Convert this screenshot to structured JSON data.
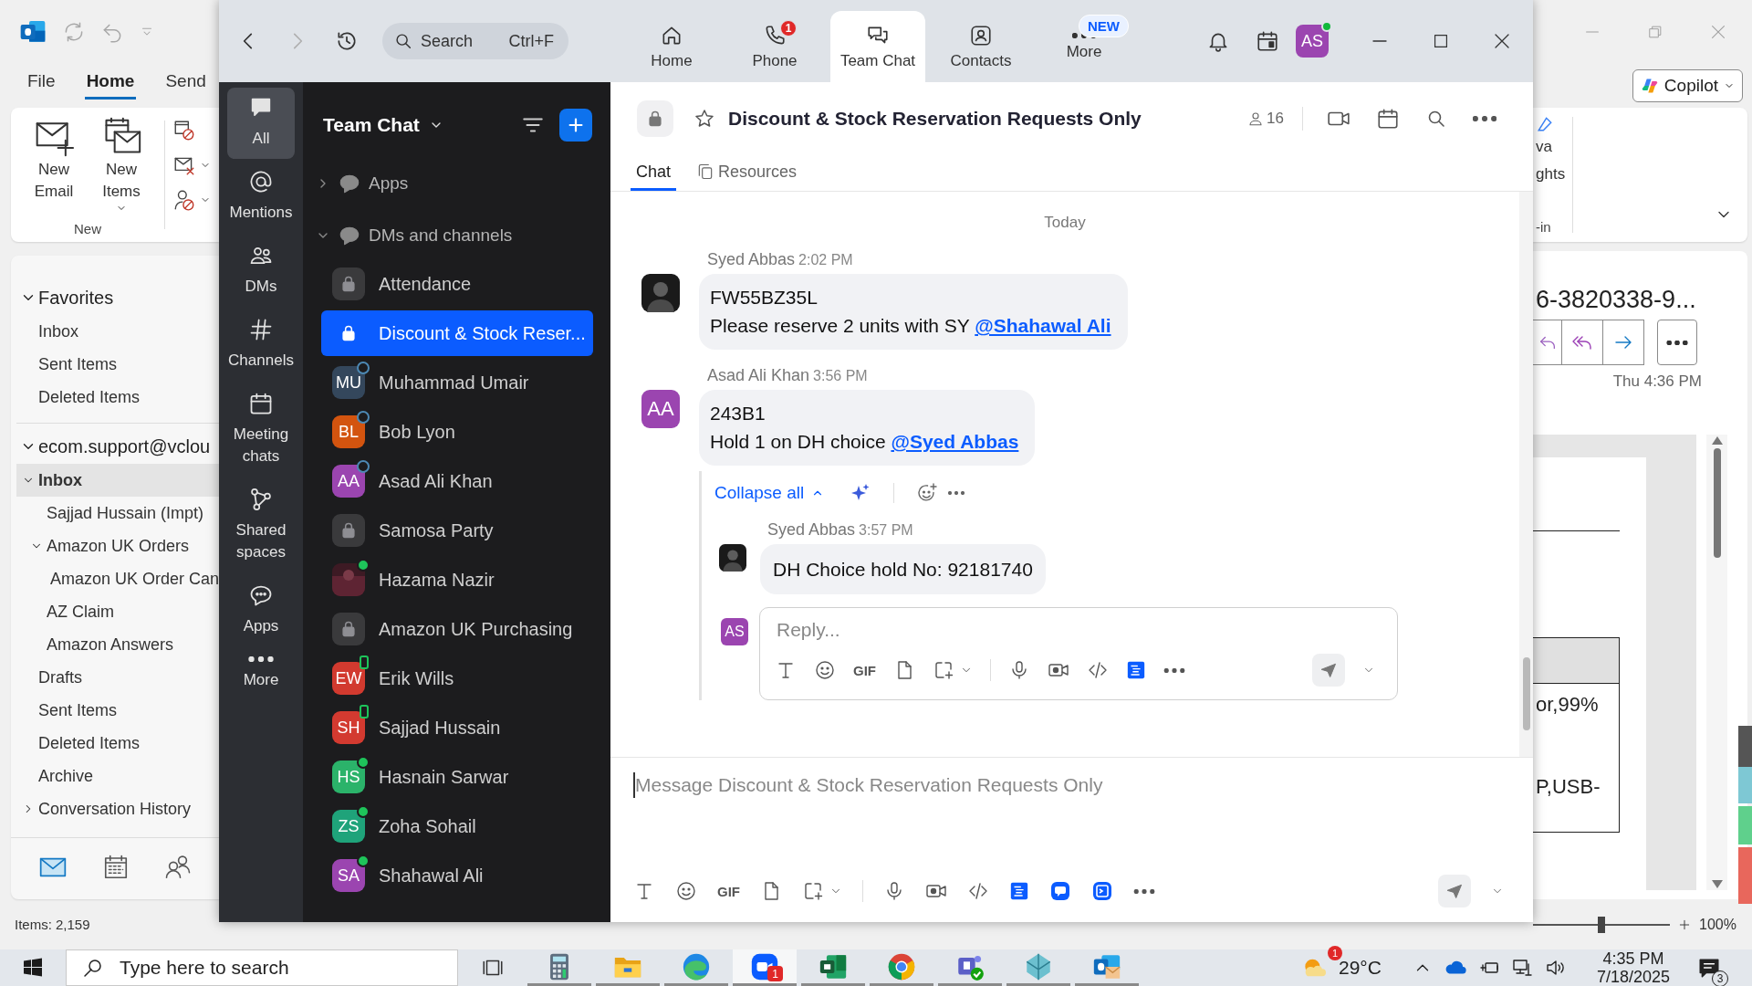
{
  "outlook": {
    "ribbon_tabs": [
      {
        "label": "File",
        "selected": false
      },
      {
        "label": "Home",
        "selected": true
      },
      {
        "label": "Send",
        "selected": false
      }
    ],
    "new_buttons": [
      {
        "kind": "email",
        "label": "New Email"
      },
      {
        "kind": "items",
        "label": "New Items"
      }
    ],
    "group_label": "New",
    "folders": [
      {
        "label": "Favorites",
        "kind": "header",
        "expanded": true,
        "selected": false,
        "children": [
          {
            "label": "Inbox",
            "selected": false
          },
          {
            "label": "Sent Items",
            "selected": false
          },
          {
            "label": "Deleted Items",
            "selected": false
          }
        ]
      },
      {
        "label": "ecom.support@vclou",
        "kind": "header",
        "expanded": true,
        "selected": false,
        "children": [
          {
            "label": "Inbox",
            "expanded": true,
            "selected": true,
            "children": [
              {
                "label": "Sajjad Hussain (Impt)",
                "selected": false
              },
              {
                "label": "Amazon UK Orders",
                "expanded": true,
                "selected": false,
                "children": [
                  {
                    "label": "Amazon UK Order Can",
                    "selected": false
                  }
                ]
              },
              {
                "label": "AZ Claim",
                "selected": false
              },
              {
                "label": "Amazon Answers",
                "selected": false
              }
            ]
          },
          {
            "label": "Drafts",
            "selected": false
          },
          {
            "label": "Sent Items",
            "selected": false
          },
          {
            "label": "Deleted Items",
            "selected": false
          },
          {
            "label": "Archive",
            "selected": false
          },
          {
            "label": "Conversation History",
            "expanded": false,
            "selected": false
          }
        ]
      }
    ],
    "status": "Items: 2,159",
    "copilot": "Copilot",
    "ribbon_fragment": {
      "lines": [
        "va",
        "ghts"
      ],
      "group_label": "-in"
    },
    "message": {
      "subject": "6-3820338-9...",
      "time": "Thu 4:36 PM",
      "cells": [
        "or,99%",
        "P,USB-"
      ]
    },
    "zoom_slider": {
      "level": 0.5
    },
    "zoom_level": "100%"
  },
  "zoom": {
    "search": {
      "placeholder": "Search",
      "shortcut": "Ctrl+F"
    },
    "nav_tabs": [
      {
        "kind": "home",
        "label": "Home",
        "selected": false
      },
      {
        "kind": "phone",
        "label": "Phone",
        "badge": "1",
        "selected": false
      },
      {
        "kind": "chat",
        "label": "Team Chat",
        "selected": true
      },
      {
        "kind": "contacts",
        "label": "Contacts",
        "selected": false
      },
      {
        "kind": "more",
        "label": "More",
        "badge": "NEW",
        "selected": false
      }
    ],
    "user_initials": "AS",
    "rail": [
      {
        "kind": "all",
        "label": "All",
        "selected": true
      },
      {
        "kind": "mentions",
        "label": "Mentions",
        "selected": false
      },
      {
        "kind": "dms",
        "label": "DMs",
        "selected": false
      },
      {
        "kind": "channels",
        "label": "Channels",
        "selected": false
      },
      {
        "kind": "meetings",
        "label": "Meeting chats",
        "selected": false
      },
      {
        "kind": "shared",
        "label": "Shared spaces",
        "selected": false
      },
      {
        "kind": "apps",
        "label": "Apps",
        "selected": false
      },
      {
        "kind": "more",
        "label": "More",
        "selected": false
      }
    ],
    "list_title": "Team Chat",
    "sections": [
      {
        "label": "Apps",
        "expanded": false
      },
      {
        "label": "DMs and channels",
        "expanded": true,
        "children": [
          {
            "kind": "channel",
            "name": "Attendance",
            "selected": false
          },
          {
            "kind": "channel",
            "name": "Discount & Stock Reser...",
            "selected": true
          },
          {
            "kind": "person",
            "name": "Muhammad Umair",
            "initials": "MU",
            "color": "#34475c",
            "presence": {
              "kind": "away"
            },
            "selected": false
          },
          {
            "kind": "person",
            "name": "Bob Lyon",
            "initials": "BL",
            "color": "#d3540f",
            "presence": {
              "kind": "away"
            },
            "selected": false
          },
          {
            "kind": "person",
            "name": "Asad Ali Khan",
            "initials": "AA",
            "color": "#9b45b0",
            "presence": {
              "kind": "away"
            },
            "selected": false
          },
          {
            "kind": "channel",
            "name": "Samosa Party",
            "selected": false
          },
          {
            "kind": "photo",
            "name": "Hazama Nazir",
            "presence": {
              "kind": "online"
            },
            "selected": false
          },
          {
            "kind": "channel",
            "name": "Amazon UK Purchasing",
            "selected": false
          },
          {
            "kind": "person",
            "name": "Erik Wills",
            "initials": "EW",
            "color": "#d23a2f",
            "presence": {
              "kind": "mobile"
            },
            "selected": false
          },
          {
            "kind": "person",
            "name": "Sajjad Hussain",
            "initials": "SH",
            "color": "#d33a30",
            "presence": {
              "kind": "mobile"
            },
            "selected": false
          },
          {
            "kind": "person",
            "name": "Hasnain Sarwar",
            "initials": "HS",
            "color": "#2bb36a",
            "presence": {
              "kind": "online"
            },
            "selected": false
          },
          {
            "kind": "person",
            "name": "Zoha Sohail",
            "initials": "ZS",
            "color": "#1fa37a",
            "presence": {
              "kind": "online"
            },
            "selected": false
          },
          {
            "kind": "person",
            "name": "Shahawal Ali",
            "initials": "SA",
            "color": "#9b45b0",
            "presence": {
              "kind": "online"
            },
            "selected": false
          }
        ]
      }
    ],
    "chat": {
      "title": "Discount & Stock Reservation Requests Only",
      "members": "16",
      "tabs": [
        {
          "kind": "chat",
          "label": "Chat",
          "selected": true
        },
        {
          "kind": "resources",
          "label": "Resources",
          "selected": false
        }
      ],
      "day": "Today",
      "messages": [
        {
          "sender": "Syed Abbas",
          "time": "2:02 PM",
          "avatar": {
            "kind": "photo"
          },
          "lines": [
            "FW55BZ35L",
            "Please reserve 2 units with SY"
          ],
          "mention": "@Shahawal Ali"
        },
        {
          "sender": "Asad Ali Khan",
          "time": "3:56 PM",
          "avatar": {
            "kind": "initials",
            "initials": "AA",
            "color": "#9b45b0"
          },
          "lines": [
            "243B1",
            "Hold 1 on DH choice"
          ],
          "mention": "@Syed Abbas",
          "thread": {
            "collapse_label": "Collapse all",
            "replies": [
              {
                "sender": "Syed Abbas",
                "time": "3:57 PM",
                "avatar": {
                  "kind": "photo"
                },
                "lines": [
                  "DH Choice hold No: 92181740"
                ]
              }
            ],
            "reply_box": {
              "initials": "AS",
              "placeholder": "Reply...",
              "gif": "GIF"
            }
          }
        }
      ],
      "composer": {
        "placeholder": "Message Discount & Stock Reservation Requests Only",
        "gif": "GIF"
      }
    }
  },
  "taskbar": {
    "search_placeholder": "Type here to search",
    "apps": [
      {
        "kind": "calculator",
        "running": true,
        "selected": false
      },
      {
        "kind": "folder",
        "running": true,
        "selected": false
      },
      {
        "kind": "edge",
        "running": true,
        "selected": false
      },
      {
        "kind": "zoom",
        "running": true,
        "selected": true,
        "badge": "1"
      },
      {
        "kind": "excel",
        "running": true,
        "selected": false
      },
      {
        "kind": "chrome",
        "running": true,
        "selected": false
      },
      {
        "kind": "teams",
        "running": true,
        "selected": false
      },
      {
        "kind": "app",
        "running": true,
        "selected": false
      },
      {
        "kind": "outlook",
        "running": true,
        "selected": false
      }
    ],
    "weather": {
      "badge": "1",
      "temperature": "29°C"
    },
    "time": "4:35 PM",
    "date": "7/18/2025",
    "notifications": "3"
  }
}
